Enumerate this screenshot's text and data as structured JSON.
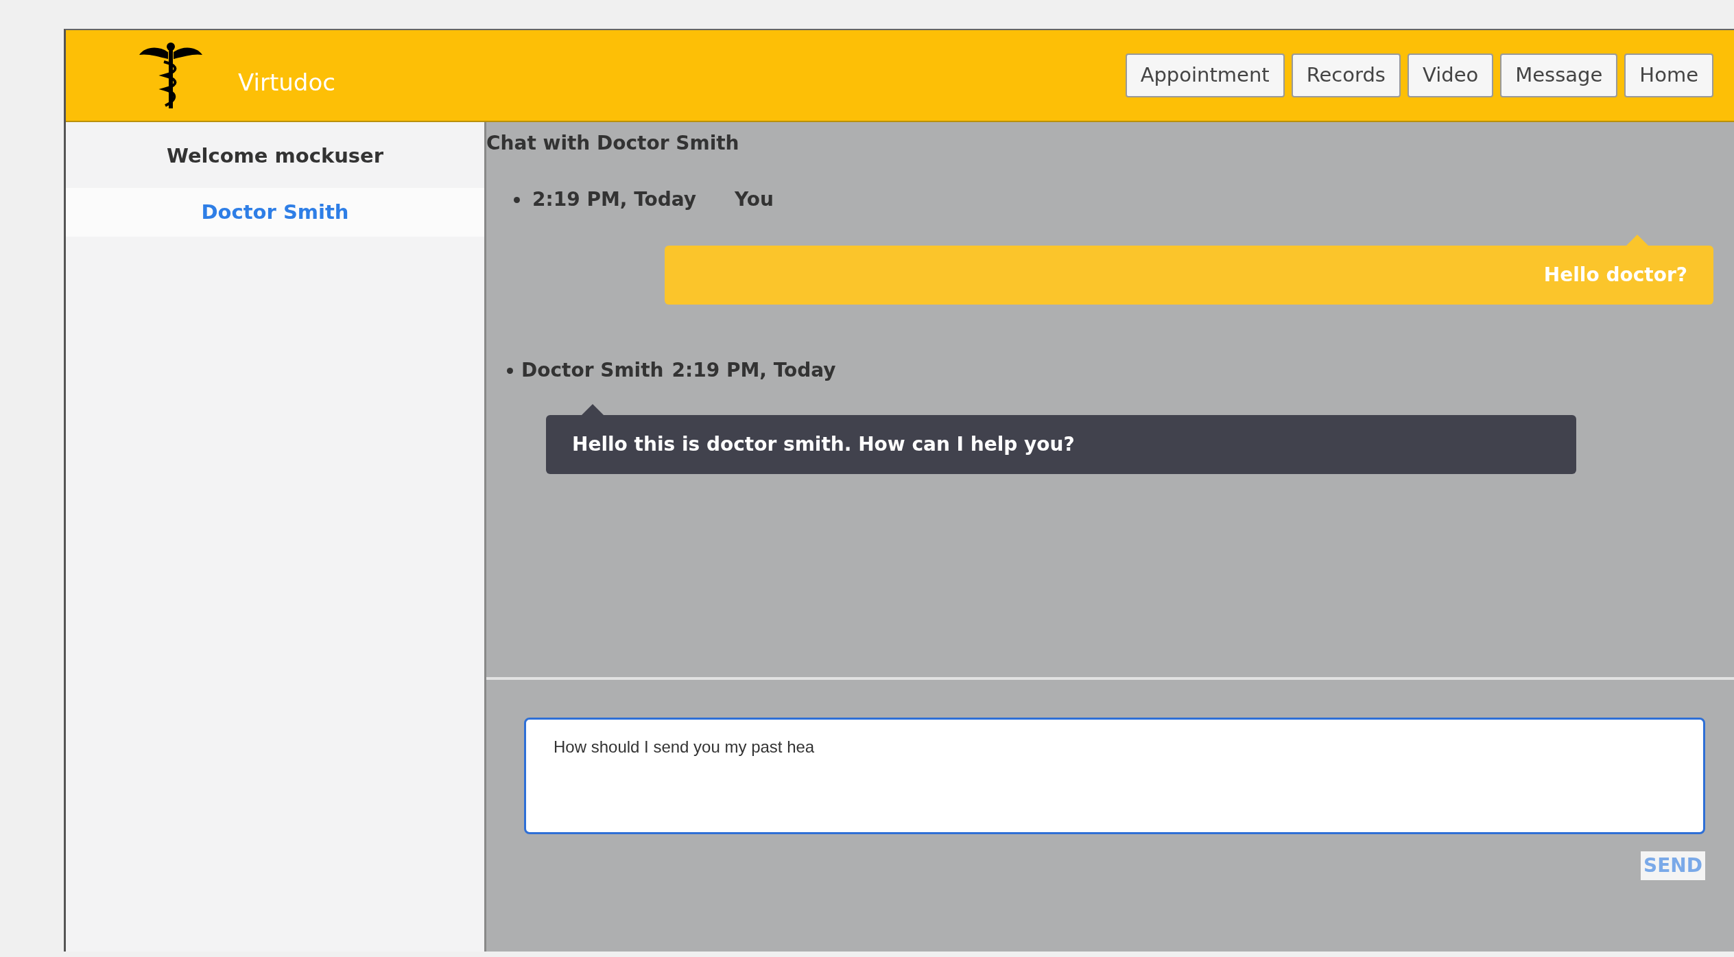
{
  "brand": {
    "name": "Virtudoc"
  },
  "nav": [
    {
      "label": "Appointment"
    },
    {
      "label": "Records"
    },
    {
      "label": "Video"
    },
    {
      "label": "Message"
    },
    {
      "label": "Home"
    }
  ],
  "sidebar": {
    "welcome": "Welcome mockuser",
    "contacts": [
      {
        "name": "Doctor Smith",
        "selected": true
      }
    ]
  },
  "chat": {
    "title": "Chat with Doctor Smith",
    "messages": [
      {
        "kind": "sent",
        "time": "2:19 PM, Today",
        "sender": "You",
        "text": "Hello doctor?"
      },
      {
        "kind": "received",
        "sender": "Doctor Smith",
        "time": "2:19 PM, Today",
        "text": "Hello this is doctor smith. How can I help you?"
      }
    ]
  },
  "composer": {
    "value": "How should I send you my past hea",
    "send": "SEND"
  }
}
